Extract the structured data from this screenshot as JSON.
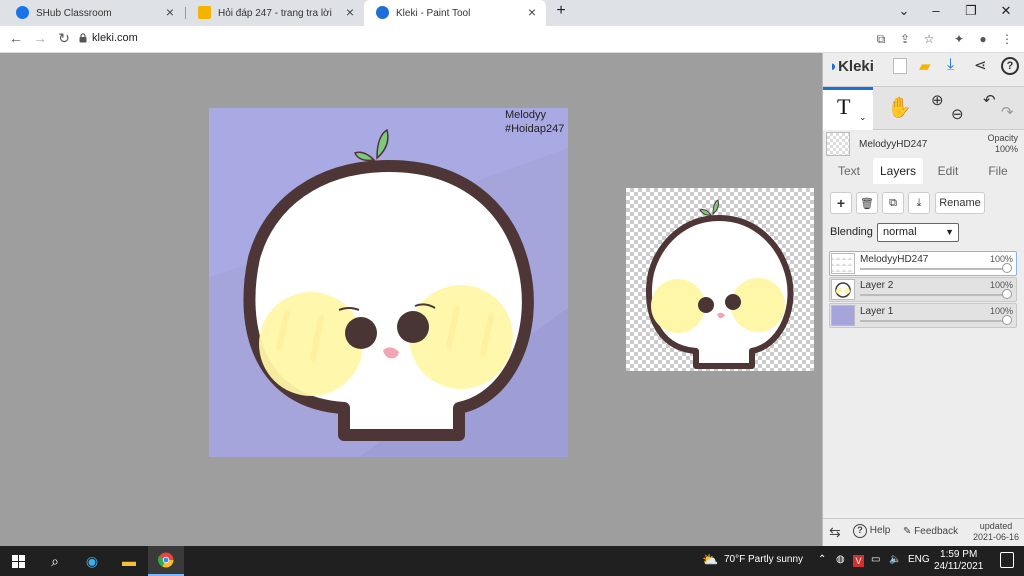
{
  "browser": {
    "tabs": [
      {
        "title": "SHub Classroom",
        "favicon_color": "#1a73e8"
      },
      {
        "title": "Hỏi đáp 247 - trang tra lời",
        "favicon_color": "#f4b400"
      },
      {
        "title": "Kleki - Paint Tool",
        "favicon_color": "#1e6fd9"
      }
    ],
    "url": "kleki.com"
  },
  "canvas": {
    "watermark_line1": "Melodyy",
    "watermark_line2": "#Hoidap247",
    "background_color": "#a5a5dc"
  },
  "panel": {
    "logo": "Kleki",
    "current_layer_name": "MelodyyHD247",
    "opacity_label": "Opacity",
    "opacity_value": "100%",
    "tabs": [
      "Text",
      "Layers",
      "Edit",
      "File"
    ],
    "active_tab": "Layers",
    "rename_label": "Rename",
    "blending_label": "Blending",
    "blending_value": "normal",
    "layers": [
      {
        "name": "MelodyyHD247",
        "opacity": "100%"
      },
      {
        "name": "Layer 2",
        "opacity": "100%"
      },
      {
        "name": "Layer 1",
        "opacity": "100%"
      }
    ],
    "help_label": "Help",
    "feedback_label": "Feedback",
    "updated_label": "updated",
    "updated_date": "2021-06-16"
  },
  "taskbar": {
    "weather": "70°F  Partly sunny",
    "language": "ENG",
    "time": "1:59 PM",
    "date": "24/11/2021"
  },
  "colors": {
    "accent": "#1e6fd9",
    "outline": "#4e3636",
    "blush": "#fff7a8",
    "leaf": "#7ccb7c"
  }
}
